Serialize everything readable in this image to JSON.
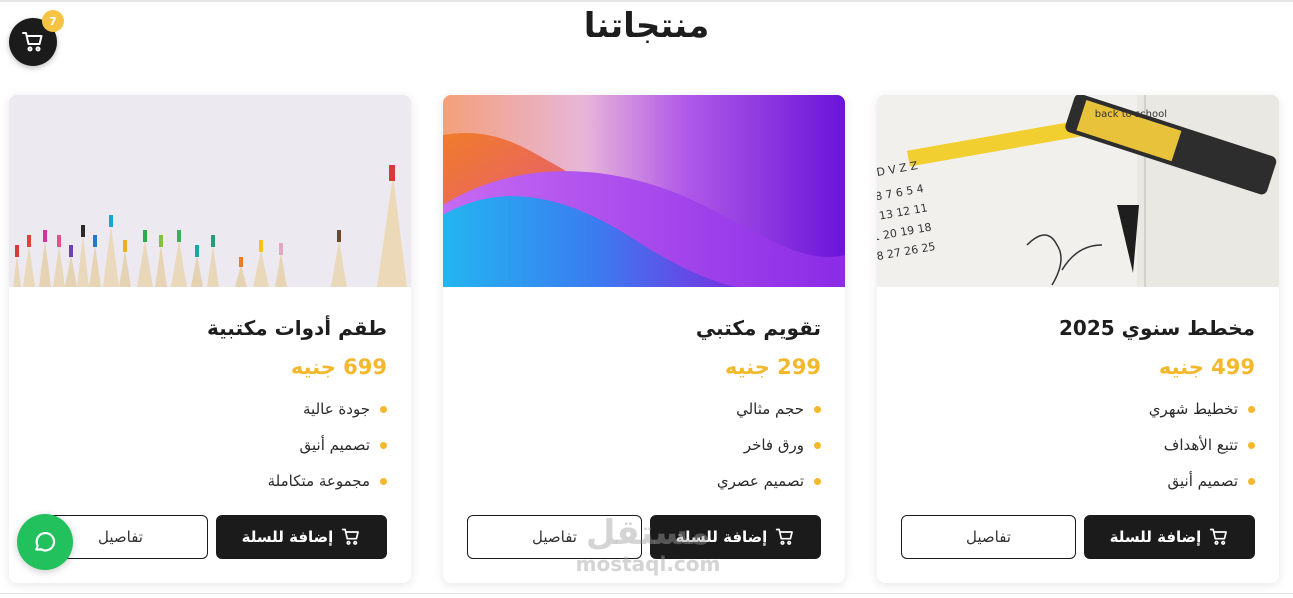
{
  "page": {
    "title": "منتجاتنا"
  },
  "cart": {
    "count": "7",
    "icon": "cart-icon"
  },
  "chat": {
    "icon": "chat-bubble-icon",
    "color": "#22c15e"
  },
  "accent_color": "#f4b82c",
  "watermark": {
    "arabic": "مستقل",
    "latin": "mostaql.com"
  },
  "products": [
    {
      "title": "مخطط سنوي 2025",
      "price": "499 جنيه",
      "image": "planner-calendar-marker-photo",
      "features": [
        "تخطيط شهري",
        "تتبع الأهداف",
        "تصميم أنيق"
      ],
      "add_label": "إضافة للسلة",
      "details_label": "تفاصيل"
    },
    {
      "title": "تقويم مكتبي",
      "price": "299 جنيه",
      "image": "gradient-wave-abstract",
      "features": [
        "حجم مثالي",
        "ورق فاخر",
        "تصميم عصري"
      ],
      "add_label": "إضافة للسلة",
      "details_label": "تفاصيل"
    },
    {
      "title": "طقم أدوات مكتبية",
      "price": "699 جنيه",
      "image": "colored-pencils-photo",
      "features": [
        "جودة عالية",
        "تصميم أنيق",
        "مجموعة متكاملة"
      ],
      "add_label": "إضافة للسلة",
      "details_label": "تفاصيل"
    }
  ]
}
